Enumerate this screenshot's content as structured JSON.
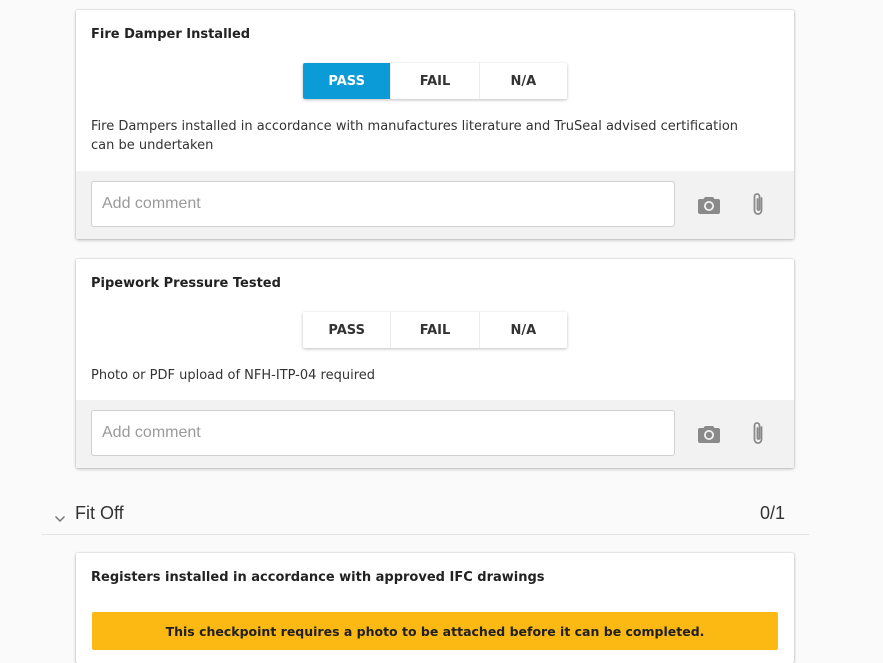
{
  "checkpoints": [
    {
      "title": "Fire Damper Installed",
      "options": [
        "PASS",
        "FAIL",
        "N/A"
      ],
      "selected": "PASS",
      "description": "Fire Dampers installed in accordance with manufactures literature and TruSeal advised certification can be undertaken",
      "comment_placeholder": "Add comment",
      "icons": [
        "camera-icon",
        "paperclip-icon"
      ]
    },
    {
      "title": "Pipework Pressure Tested",
      "options": [
        "PASS",
        "FAIL",
        "N/A"
      ],
      "selected": "",
      "description": "Photo or PDF upload of NFH-ITP-04 required",
      "comment_placeholder": "Add comment",
      "icons": [
        "camera-icon",
        "paperclip-icon"
      ]
    }
  ],
  "section": {
    "title": "Fit Off",
    "count": "0/1",
    "icon": "chevron-down-icon"
  },
  "next_checkpoint": {
    "title": "Registers installed in accordance with approved IFC drawings",
    "warning": "This checkpoint requires a photo to be attached before it can be completed."
  },
  "colors": {
    "accent": "#0b9bd6",
    "warning": "#fdb913",
    "comment_bg": "#f2f2f2"
  }
}
